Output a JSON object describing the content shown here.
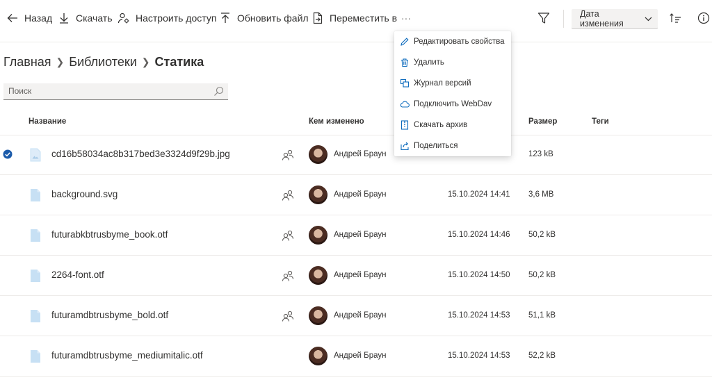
{
  "toolbar": {
    "back_label": "Назад",
    "download_label": "Скачать",
    "access_label": "Настроить доступ",
    "update_label": "Обновить файл",
    "move_label": "Переместить в",
    "more_label": "···",
    "sort_label": "Дата изменения"
  },
  "breadcrumb": {
    "items": [
      "Главная",
      "Библиотеки"
    ],
    "current": "Статика"
  },
  "search": {
    "placeholder": "Поиск",
    "value": ""
  },
  "table": {
    "headers": {
      "name": "Название",
      "modified_by": "Кем изменено",
      "size": "Размер",
      "tags": "Теги"
    },
    "rows": [
      {
        "name": "cd16b58034ac8b317bed3e3324d9f29b.jpg",
        "author": "Андрей Браун",
        "date": "",
        "size": "123 kB",
        "selected": true,
        "type": "image",
        "shared": true
      },
      {
        "name": "background.svg",
        "author": "Андрей Браун",
        "date": "15.10.2024 14:41",
        "size": "3,6 MB",
        "selected": false,
        "type": "file",
        "shared": true
      },
      {
        "name": "futurabkbtrusbyme_book.otf",
        "author": "Андрей Браун",
        "date": "15.10.2024 14:46",
        "size": "50,2 kB",
        "selected": false,
        "type": "file",
        "shared": true
      },
      {
        "name": "2264-font.otf",
        "author": "Андрей Браун",
        "date": "15.10.2024 14:50",
        "size": "50,2 kB",
        "selected": false,
        "type": "file",
        "shared": true
      },
      {
        "name": "futuramdbtrusbyme_bold.otf",
        "author": "Андрей Браун",
        "date": "15.10.2024 14:53",
        "size": "51,1 kB",
        "selected": false,
        "type": "file",
        "shared": true
      },
      {
        "name": "futuramdbtrusbyme_mediumitalic.otf",
        "author": "Андрей Браун",
        "date": "15.10.2024 14:53",
        "size": "52,2 kB",
        "selected": false,
        "type": "file",
        "shared": false
      }
    ]
  },
  "context_menu": {
    "items": [
      {
        "label": "Редактировать свойства",
        "icon": "pencil-icon"
      },
      {
        "label": "Удалить",
        "icon": "trash-icon"
      },
      {
        "label": "Журнал версий",
        "icon": "version-history-icon"
      },
      {
        "label": "Подключить WebDav",
        "icon": "cloud-icon"
      },
      {
        "label": "Скачать архив",
        "icon": "archive-icon"
      },
      {
        "label": "Поделиться",
        "icon": "share-out-icon"
      }
    ]
  },
  "colors": {
    "accent": "#0f6cbd",
    "selected_check": "#1b5baa",
    "file_icon": "#c7e0f4",
    "text": "#323130",
    "divider": "#edebe9"
  }
}
